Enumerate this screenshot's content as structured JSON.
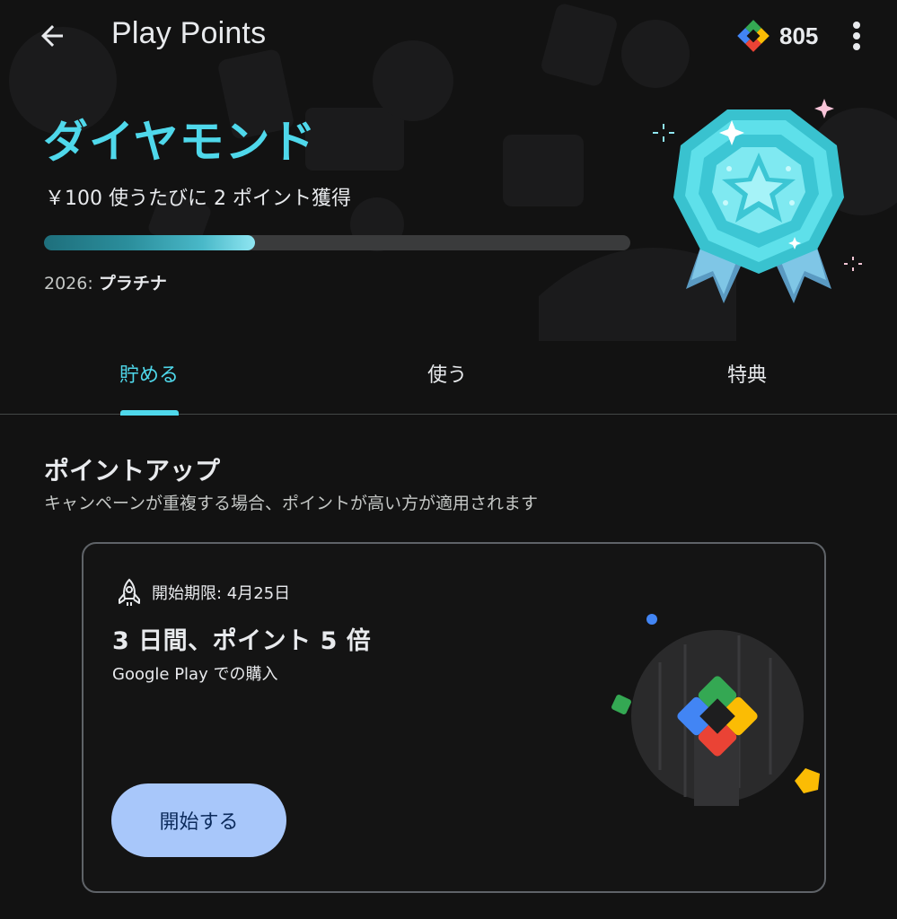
{
  "appbar": {
    "title": "Play Points",
    "points": "805",
    "back_icon": "arrow-back-icon",
    "menu_icon": "more-vert-icon"
  },
  "tier": {
    "name": "ダイヤモンド",
    "rate": "￥100 使うたびに 2 ポイント獲得",
    "progress": 0.36,
    "next_year": "2026:",
    "next_tier": "プラチナ",
    "accent": "#4fd8eb"
  },
  "tabs": [
    {
      "label": "貯める",
      "active": true
    },
    {
      "label": "使う",
      "active": false
    },
    {
      "label": "特典",
      "active": false
    }
  ],
  "section": {
    "title": "ポイントアップ",
    "subtitle": "キャンペーンが重複する場合、ポイントが高い方が適用されます"
  },
  "campaign": {
    "icon": "rocket-icon",
    "deadline": "開始期限: 4月25日",
    "title": "3 日間、ポイント 5 倍",
    "description": "Google Play での購入",
    "button_label": "開始する",
    "button_color": "#a8c7fa"
  }
}
